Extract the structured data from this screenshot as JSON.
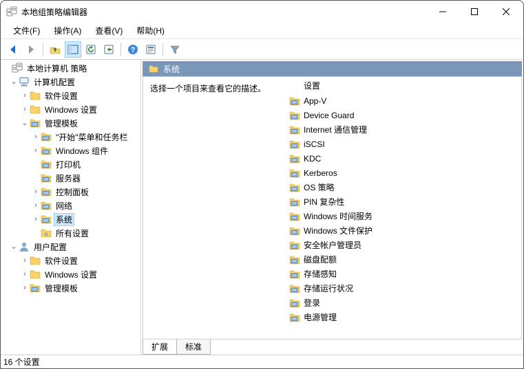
{
  "window": {
    "title": "本地组策略编辑器"
  },
  "menubar": {
    "file": "文件(F)",
    "action": "操作(A)",
    "view": "查看(V)",
    "help": "帮助(H)"
  },
  "tree": {
    "root": "本地计算机 策略",
    "computer_config": "计算机配置",
    "software_settings_1": "软件设置",
    "windows_settings_1": "Windows 设置",
    "admin_templates_1": "管理模板",
    "start_menu_taskbar": "\"开始\"菜单和任务栏",
    "windows_components": "Windows 组件",
    "printers": "打印机",
    "servers": "服务器",
    "control_panel": "控制面板",
    "network": "网络",
    "system": "系统",
    "all_settings": "所有设置",
    "user_config": "用户配置",
    "software_settings_2": "软件设置",
    "windows_settings_2": "Windows 设置",
    "admin_templates_2": "管理模板"
  },
  "right": {
    "header": "系统",
    "desc_prompt": "选择一个项目来查看它的描述。",
    "settings_header": "设置",
    "items": [
      "App-V",
      "Device Guard",
      "Internet 通信管理",
      "iSCSI",
      "KDC",
      "Kerberos",
      "OS 策略",
      "PIN 复杂性",
      "Windows 时间服务",
      "Windows 文件保护",
      "安全帐户管理员",
      "磁盘配额",
      "存储感知",
      "存储运行状况",
      "登录",
      "电源管理"
    ],
    "tabs": {
      "extended": "扩展",
      "standard": "标准"
    }
  },
  "statusbar": {
    "text": "16 个设置"
  }
}
